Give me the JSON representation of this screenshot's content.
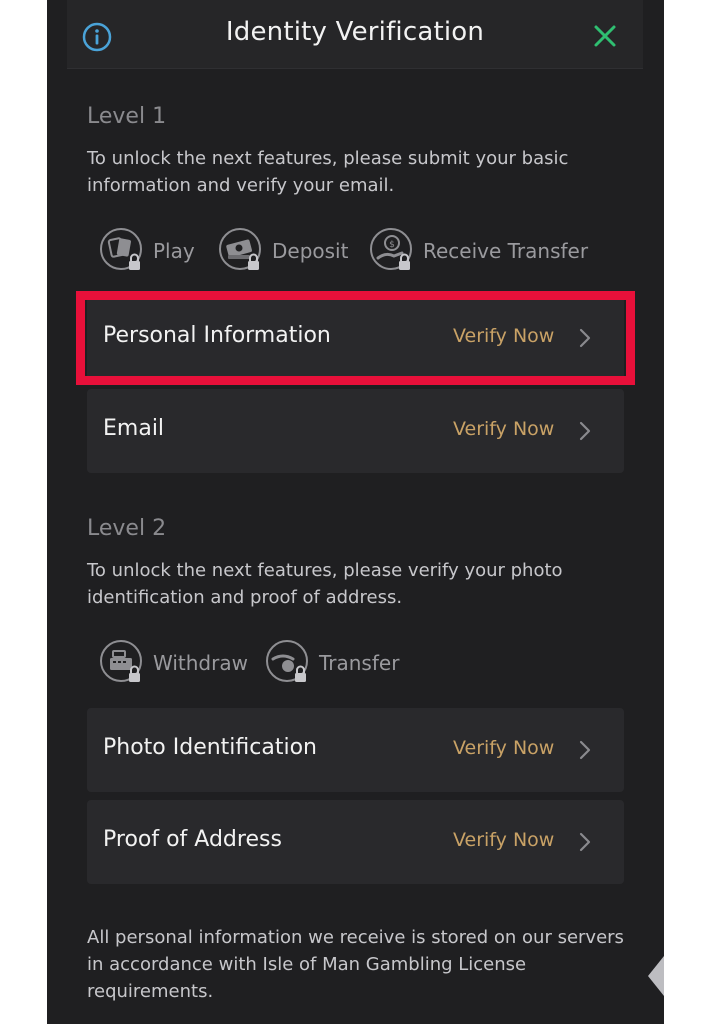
{
  "header": {
    "title": "Identity Verification"
  },
  "level1": {
    "title": "Level 1",
    "description": "To unlock the next features, please submit your basic information and verify your email.",
    "features": [
      {
        "label": "Play",
        "icon": "cards-lock-icon"
      },
      {
        "label": "Deposit",
        "icon": "money-lock-icon"
      },
      {
        "label": "Receive Transfer",
        "icon": "coin-hand-lock-icon"
      }
    ],
    "rows": [
      {
        "label": "Personal Information",
        "action": "Verify Now"
      },
      {
        "label": "Email",
        "action": "Verify Now"
      }
    ]
  },
  "level2": {
    "title": "Level 2",
    "description": "To unlock the next features, please verify your photo identification and proof of address.",
    "features": [
      {
        "label": "Withdraw",
        "icon": "register-lock-icon"
      },
      {
        "label": "Transfer",
        "icon": "coin-give-lock-icon"
      }
    ],
    "rows": [
      {
        "label": "Photo Identification",
        "action": "Verify Now"
      },
      {
        "label": "Proof of Address",
        "action": "Verify Now"
      }
    ]
  },
  "footer": "All personal information we receive is stored on our servers in accordance with Isle of Man Gambling License requirements.",
  "colors": {
    "accent": "#c9a266",
    "close": "#2fbf71",
    "info": "#4aa3d8",
    "highlight": "#e8103a",
    "panel": "#1f1f21"
  }
}
